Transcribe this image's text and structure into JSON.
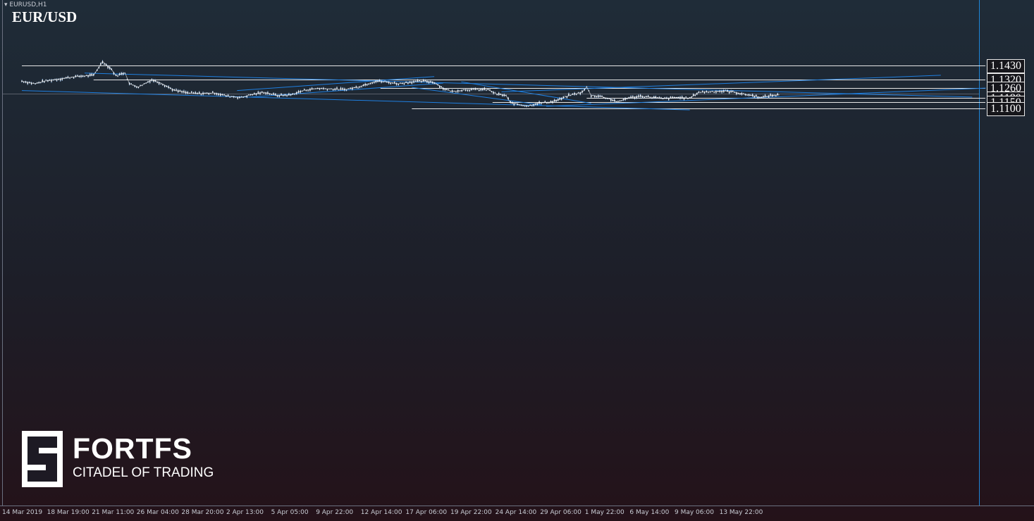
{
  "header": {
    "timeframe_label": "EURUSD,H1",
    "symbol": "EUR/USD"
  },
  "branding": {
    "name": "FORTFS",
    "tagline": "CITADEL OF TRADING"
  },
  "colors": {
    "trendline": "#1e7fe0",
    "level": "#e6e6e6",
    "candle": "#ffffff",
    "wick": "#9cc3ee",
    "crosshair": "#5a5f6a"
  },
  "chart_data": {
    "type": "line",
    "title": "EUR/USD",
    "timeframe": "H1",
    "x_ticks": [
      "14 Mar 2019",
      "18 Mar 19:00",
      "21 Mar 11:00",
      "26 Mar 04:00",
      "28 Mar 20:00",
      "2 Apr 13:00",
      "5 Apr 05:00",
      "9 Apr 22:00",
      "12 Apr 14:00",
      "17 Apr 06:00",
      "19 Apr 22:00",
      "24 Apr 14:00",
      "29 Apr 06:00",
      "1 May 22:00",
      "6 May 14:00",
      "9 May 06:00",
      "13 May 22:00"
    ],
    "levels": [
      {
        "label": "1.1430",
        "value": 1.143,
        "from": 0.0
      },
      {
        "label": "1.1320",
        "value": 1.132,
        "from": 1.6
      },
      {
        "label": "1.1260",
        "value": 1.126,
        "from": 8.0
      },
      {
        "label": "1.1180",
        "value": 1.118,
        "from": 12.6
      },
      {
        "label": "1.1150",
        "value": 1.115,
        "from": 10.5
      },
      {
        "label": "1.1100",
        "value": 1.11,
        "from": 8.7
      }
    ],
    "price_path": [
      [
        0.0,
        1.131
      ],
      [
        0.3,
        1.129
      ],
      [
        0.5,
        1.131
      ],
      [
        0.9,
        1.133
      ],
      [
        1.2,
        1.1345
      ],
      [
        1.6,
        1.1355
      ],
      [
        1.8,
        1.146
      ],
      [
        2.0,
        1.14
      ],
      [
        2.1,
        1.135
      ],
      [
        2.3,
        1.1375
      ],
      [
        2.4,
        1.129
      ],
      [
        2.6,
        1.1265
      ],
      [
        2.9,
        1.132
      ],
      [
        3.1,
        1.1295
      ],
      [
        3.4,
        1.124
      ],
      [
        3.7,
        1.122
      ],
      [
        4.0,
        1.1215
      ],
      [
        4.3,
        1.122
      ],
      [
        4.6,
        1.1195
      ],
      [
        4.9,
        1.1185
      ],
      [
        5.1,
        1.1205
      ],
      [
        5.4,
        1.1225
      ],
      [
        5.7,
        1.12
      ],
      [
        6.0,
        1.1205
      ],
      [
        6.3,
        1.124
      ],
      [
        6.6,
        1.1255
      ],
      [
        6.9,
        1.125
      ],
      [
        7.2,
        1.1245
      ],
      [
        7.5,
        1.1265
      ],
      [
        7.9,
        1.131
      ],
      [
        8.1,
        1.1305
      ],
      [
        8.4,
        1.129
      ],
      [
        8.7,
        1.1305
      ],
      [
        9.0,
        1.131
      ],
      [
        9.2,
        1.13
      ],
      [
        9.4,
        1.1255
      ],
      [
        9.6,
        1.123
      ],
      [
        9.9,
        1.1245
      ],
      [
        10.2,
        1.1245
      ],
      [
        10.4,
        1.1245
      ],
      [
        10.6,
        1.121
      ],
      [
        10.8,
        1.12
      ],
      [
        10.9,
        1.1145
      ],
      [
        11.1,
        1.113
      ],
      [
        11.3,
        1.112
      ],
      [
        11.5,
        1.114
      ],
      [
        11.8,
        1.115
      ],
      [
        12.0,
        1.117
      ],
      [
        12.2,
        1.12
      ],
      [
        12.5,
        1.1225
      ],
      [
        12.6,
        1.1265
      ],
      [
        12.7,
        1.12
      ],
      [
        12.9,
        1.1195
      ],
      [
        13.1,
        1.1175
      ],
      [
        13.3,
        1.115
      ],
      [
        13.5,
        1.118
      ],
      [
        13.8,
        1.1195
      ],
      [
        14.1,
        1.1185
      ],
      [
        14.3,
        1.1175
      ],
      [
        14.6,
        1.1185
      ],
      [
        14.9,
        1.118
      ],
      [
        15.1,
        1.1225
      ],
      [
        15.4,
        1.123
      ],
      [
        15.7,
        1.1235
      ],
      [
        15.9,
        1.1225
      ],
      [
        16.1,
        1.121
      ],
      [
        16.3,
        1.12
      ],
      [
        16.5,
        1.1185
      ],
      [
        16.7,
        1.12
      ],
      [
        16.9,
        1.1205
      ]
    ],
    "trendlines": [
      {
        "x1": 1.4,
        "y1": 1.1372,
        "x2": 21.2,
        "y2": 1.1188
      },
      {
        "x1": 0.0,
        "y1": 1.1238,
        "x2": 14.9,
        "y2": 1.109
      },
      {
        "x1": 4.8,
        "y1": 1.1238,
        "x2": 9.2,
        "y2": 1.1345
      },
      {
        "x1": 5.1,
        "y1": 1.1188,
        "x2": 9.4,
        "y2": 1.1295
      },
      {
        "x1": 8.7,
        "y1": 1.1262,
        "x2": 11.6,
        "y2": 1.1128
      },
      {
        "x1": 9.8,
        "y1": 1.1305,
        "x2": 12.7,
        "y2": 1.114
      },
      {
        "x1": 10.7,
        "y1": 1.1228,
        "x2": 20.5,
        "y2": 1.1355
      },
      {
        "x1": 11.7,
        "y1": 1.1117,
        "x2": 21.5,
        "y2": 1.1257
      }
    ],
    "current_price_line": 1.1212,
    "ylim": [
      1.109,
      1.148
    ]
  }
}
